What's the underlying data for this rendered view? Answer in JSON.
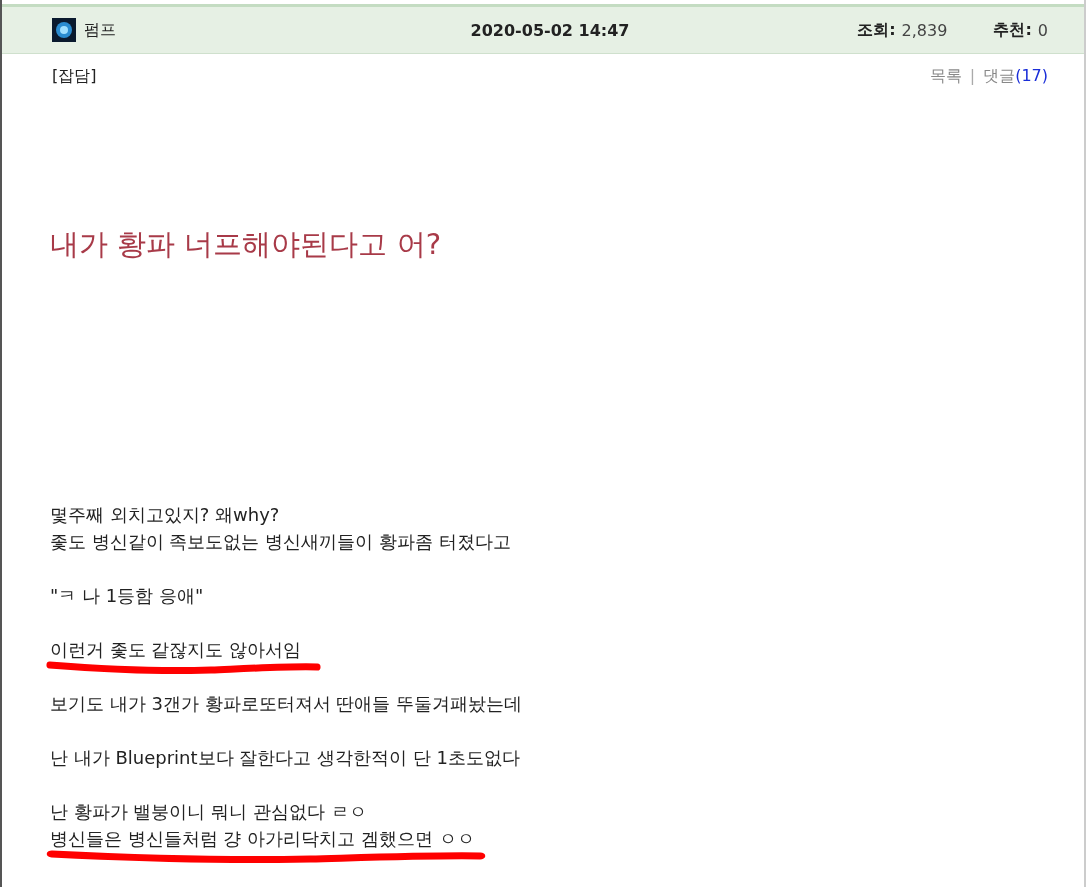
{
  "header": {
    "author": "펌프",
    "datetime": "2020-05-02 14:47",
    "views_label": "조회:",
    "views": "2,839",
    "recommend_label": "추천:",
    "recommend": "0"
  },
  "category": "[잡담]",
  "links": {
    "list": "목록",
    "separator": "|",
    "comments": "댓글",
    "comment_count": "(17)"
  },
  "title": "내가 황파 너프해야된다고 어?",
  "paragraphs": [
    [
      {
        "text": "몇주째 외치고있지? 왜why?",
        "marked": false
      },
      {
        "text": "좇도 병신같이 족보도없는 병신새끼들이 황파좀 터졌다고",
        "marked": false
      }
    ],
    [
      {
        "text": "\"ㅋ 나 1등함 응애\"",
        "marked": false
      }
    ],
    [
      {
        "text": "이런거 좇도 같잖지도 않아서임",
        "marked": true
      }
    ],
    [
      {
        "text": "보기도 내가 3갠가 황파로또터져서 딴애들 뚜둘겨패놨는데",
        "marked": false
      }
    ],
    [
      {
        "text": "난 내가 Blueprint보다 잘한다고 생각한적이 단 1초도없다",
        "marked": false
      }
    ],
    [
      {
        "text": "난 황파가 밸붕이니 뭐니 관심없다 ㄹㅇ",
        "marked": false
      },
      {
        "text": "병신들은 병신들처럼 걍 아가리닥치고 겜했으면 ㅇㅇ",
        "marked": true
      }
    ]
  ]
}
